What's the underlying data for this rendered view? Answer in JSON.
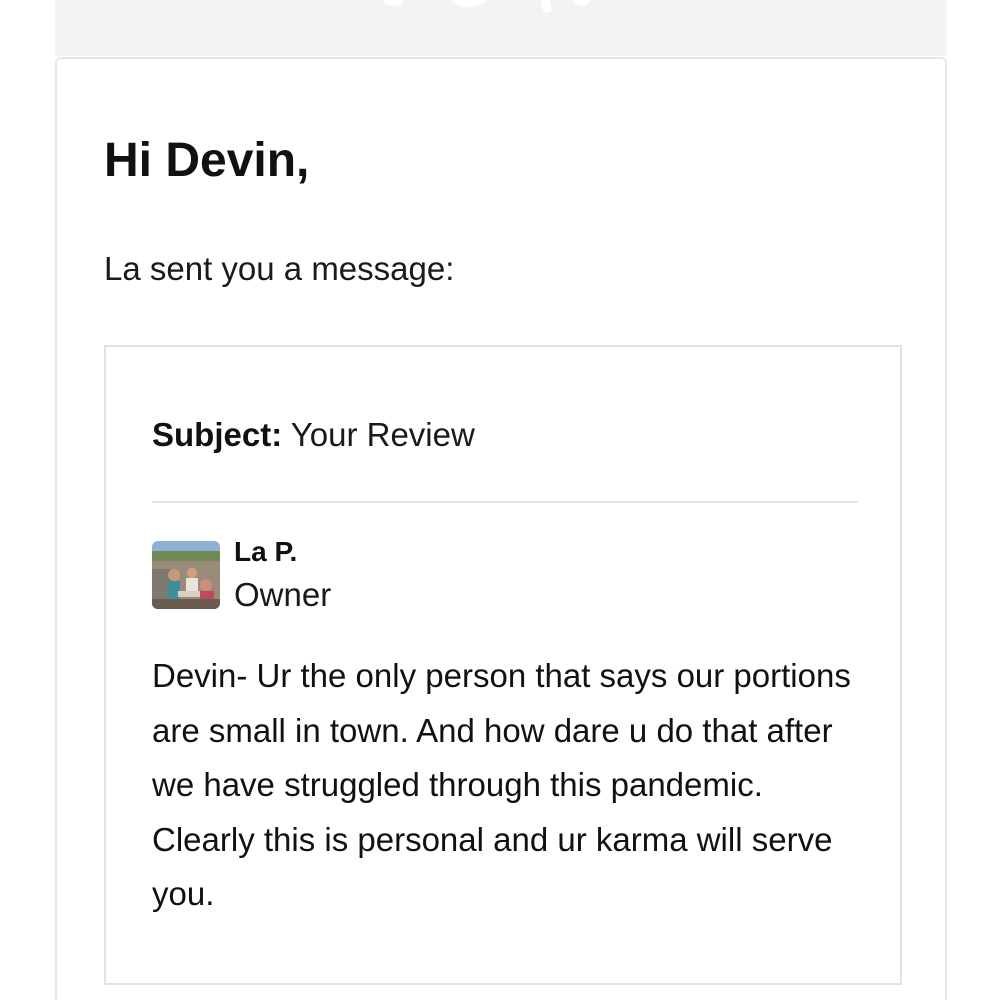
{
  "email": {
    "greeting": "Hi Devin,",
    "intro": "La sent you a message:",
    "message": {
      "subject_label": "Subject:",
      "subject_value": "Your Review",
      "sender": {
        "name": "La P.",
        "role": "Owner"
      },
      "body": "Devin- Ur the only person that says our portions are small in town. And how dare u do that after we have struggled through this pandemic. Clearly this is personal and ur karma will serve you."
    }
  }
}
